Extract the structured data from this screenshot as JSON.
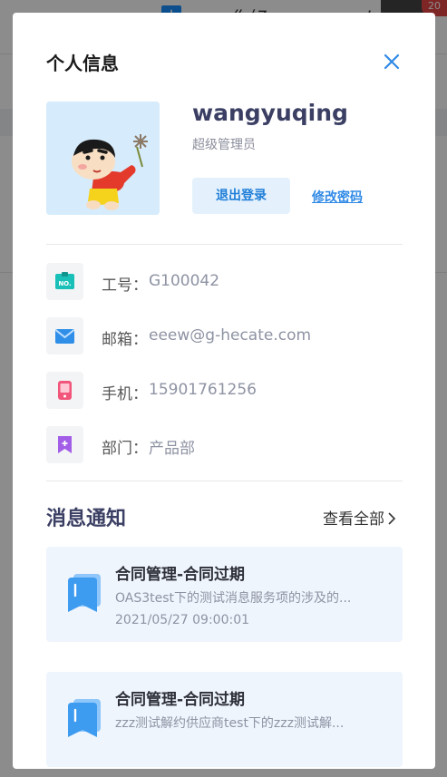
{
  "background": {
    "greeting": "你好，wangyuqing",
    "badge_count": "20"
  },
  "modal": {
    "title": "个人信息",
    "profile": {
      "username": "wangyuqing",
      "role": "超级管理员",
      "logout_label": "退出登录",
      "change_password_label": "修改密码"
    },
    "info": {
      "employee_id": {
        "label": "工号：",
        "value": "G100042",
        "icon": "id-badge-icon",
        "color": "#19c0b8"
      },
      "email": {
        "label": "邮箱：",
        "value": "eeew@g-hecate.com",
        "icon": "mail-icon",
        "color": "#2f8ee8"
      },
      "phone": {
        "label": "手机：",
        "value": "15901761256",
        "icon": "phone-icon",
        "color": "#f2557a"
      },
      "department": {
        "label": "部门：",
        "value": "产品部",
        "icon": "bookmark-icon",
        "color": "#a35ee8"
      }
    },
    "notifications": {
      "title": "消息通知",
      "view_all_label": "查看全部",
      "items": [
        {
          "title": "合同管理-合同过期",
          "description": "OAS3test下的测试消息服务项的涉及的...",
          "time": "2021/05/27 09:00:01"
        },
        {
          "title": "合同管理-合同过期",
          "description": "zzz测试解约供应商test下的zzz测试解..."
        }
      ]
    }
  }
}
